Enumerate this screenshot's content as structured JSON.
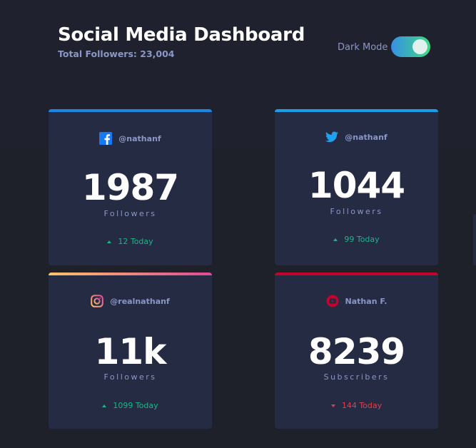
{
  "header": {
    "title": "Social Media Dashboard",
    "total_followers": "Total Followers: 23,004",
    "dark_mode_label": "Dark Mode",
    "dark_mode_on": true
  },
  "colors": {
    "facebook": "#1877f2",
    "twitter": "#1da1f2",
    "instagram_gradient": [
      "#fdc468",
      "#df4996"
    ],
    "youtube": "#c4032a",
    "up": "#1eb589",
    "down": "#dc414c"
  },
  "cards": [
    {
      "platform": "facebook",
      "icon": "facebook-icon",
      "handle": "@nathanf",
      "count": "1987",
      "label": "Followers",
      "today": "12 Today",
      "trend": "up"
    },
    {
      "platform": "twitter",
      "icon": "twitter-icon",
      "handle": "@nathanf",
      "count": "1044",
      "label": "Followers",
      "today": "99 Today",
      "trend": "up"
    },
    {
      "platform": "instagram",
      "icon": "instagram-icon",
      "handle": "@realnathanf",
      "count": "11k",
      "label": "Followers",
      "today": "1099 Today",
      "trend": "up"
    },
    {
      "platform": "youtube",
      "icon": "youtube-icon",
      "handle": "Nathan F.",
      "count": "8239",
      "label": "Subscribers",
      "today": "144 Today",
      "trend": "down"
    }
  ]
}
